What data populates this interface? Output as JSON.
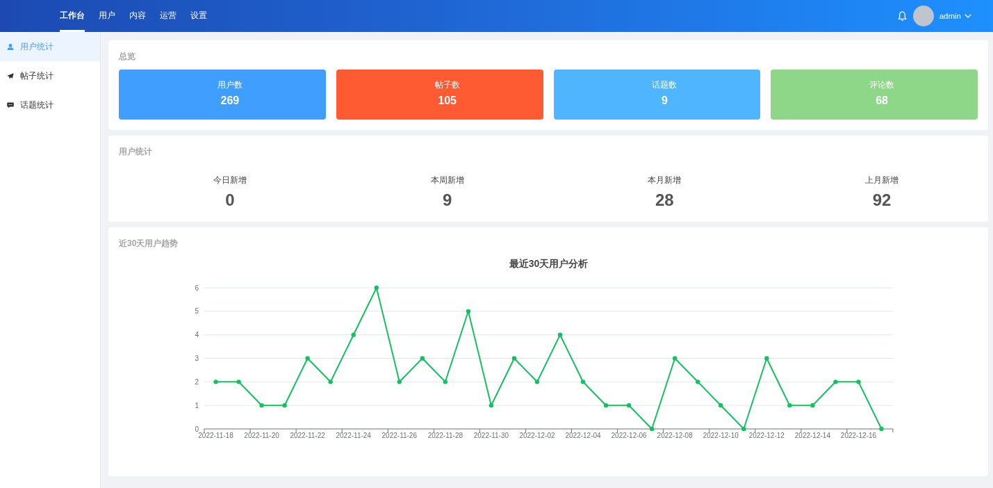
{
  "header": {
    "nav": [
      {
        "label": "工作台",
        "selected": true
      },
      {
        "label": "用户",
        "selected": false
      },
      {
        "label": "内容",
        "selected": false
      },
      {
        "label": "运营",
        "selected": false
      },
      {
        "label": "设置",
        "selected": false
      }
    ],
    "user": {
      "name": "admin"
    }
  },
  "sidebar": {
    "items": [
      {
        "label": "用户统计",
        "selected": true
      },
      {
        "label": "帖子统计",
        "selected": false
      },
      {
        "label": "话题统计",
        "selected": false
      }
    ]
  },
  "overview": {
    "title": "总览",
    "tiles": [
      {
        "label": "用户数",
        "value": "269",
        "color": "#409eff"
      },
      {
        "label": "帖子数",
        "value": "105",
        "color": "#ff5b33"
      },
      {
        "label": "话题数",
        "value": "9",
        "color": "#4fb5ff"
      },
      {
        "label": "评论数",
        "value": "68",
        "color": "#8ed789"
      }
    ]
  },
  "user_stats": {
    "title": "用户统计",
    "items": [
      {
        "label": "今日新增",
        "value": "0"
      },
      {
        "label": "本周新增",
        "value": "9"
      },
      {
        "label": "本月新增",
        "value": "28"
      },
      {
        "label": "上月新增",
        "value": "92"
      }
    ]
  },
  "trend": {
    "title": "近30天用户趋势",
    "chart_data": {
      "type": "line",
      "title": "最近30天用户分析",
      "categories": [
        "2022-11-18",
        null,
        "2022-11-20",
        null,
        "2022-11-22",
        null,
        "2022-11-24",
        null,
        "2022-11-26",
        null,
        "2022-11-28",
        null,
        "2022-11-30",
        null,
        "2022-12-02",
        null,
        "2022-12-04",
        null,
        "2022-12-06",
        null,
        "2022-12-08",
        null,
        "2022-12-10",
        null,
        "2022-12-12",
        null,
        "2022-12-14",
        null,
        "2022-12-16",
        null
      ],
      "ylim": [
        0,
        6
      ],
      "yticks": [
        0,
        1,
        2,
        3,
        4,
        5,
        6
      ],
      "grid": true,
      "series": [
        {
          "color": "#14c161",
          "marker": "circle",
          "values": [
            2,
            2,
            1,
            1,
            3,
            2,
            4,
            6,
            2,
            3,
            2,
            5,
            1,
            3,
            2,
            4,
            2,
            1,
            1,
            0,
            3,
            2,
            1,
            0,
            3,
            1,
            1,
            2,
            2,
            0
          ]
        }
      ]
    }
  }
}
